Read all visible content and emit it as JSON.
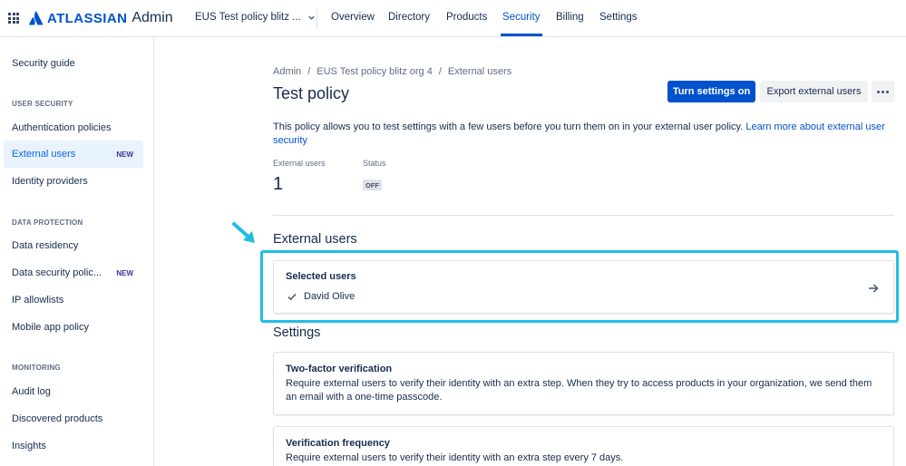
{
  "topnav": {
    "brand": "ATLASSIAN",
    "product": "Admin",
    "org_selector": "EUS Test policy blitz ...",
    "tabs": [
      {
        "label": "Overview"
      },
      {
        "label": "Directory"
      },
      {
        "label": "Products"
      },
      {
        "label": "Security"
      },
      {
        "label": "Billing"
      },
      {
        "label": "Settings"
      }
    ],
    "active_tab": "Security"
  },
  "sidebar": {
    "guide": "Security guide",
    "sections": [
      {
        "heading": "USER SECURITY"
      },
      {
        "heading": "DATA PROTECTION"
      },
      {
        "heading": "MONITORING"
      }
    ],
    "items": [
      {
        "label": "Authentication policies"
      },
      {
        "label": "External users",
        "badge": "NEW"
      },
      {
        "label": "Identity providers"
      },
      {
        "label": "Data residency"
      },
      {
        "label": "Data security polic...",
        "badge": "NEW"
      },
      {
        "label": "IP allowlists"
      },
      {
        "label": "Mobile app policy"
      },
      {
        "label": "Audit log"
      },
      {
        "label": "Discovered products"
      },
      {
        "label": "Insights"
      }
    ]
  },
  "breadcrumb": [
    "Admin",
    "EUS Test policy blitz org 4",
    "External users"
  ],
  "page": {
    "title": "Test policy",
    "turn_on_label": "Turn settings on",
    "export_label": "Export external users",
    "description": "This policy allows you to test settings with a few users before you turn them on in your external user policy. ",
    "description_link": "Learn more about external user security"
  },
  "stats": {
    "external_users_label": "External users",
    "external_users_value": "1",
    "status_label": "Status",
    "status_value": "OFF"
  },
  "external_users_section": {
    "heading": "External users",
    "card_title": "Selected users",
    "users": [
      "David Olive"
    ]
  },
  "settings_section": {
    "heading": "Settings",
    "cards": [
      {
        "title": "Two-factor verification",
        "body": "Require external users to verify their identity with an extra step. When they try to access products in your organization, we send them an email with a one-time passcode."
      },
      {
        "title": "Verification frequency",
        "body": "Require external users to verify their identity with an extra step every 7 days."
      }
    ]
  },
  "colors": {
    "primary": "#0052cc",
    "highlight": "#1fbde3",
    "selected_bg": "#e9f2ff"
  }
}
